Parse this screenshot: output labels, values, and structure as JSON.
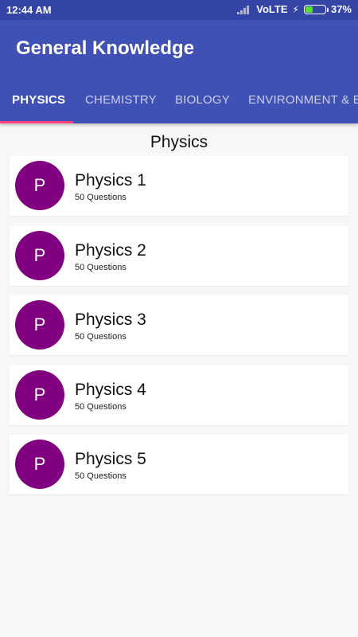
{
  "status_bar": {
    "time": "12:44 AM",
    "network": "VoLTE",
    "battery_percent": "37%",
    "battery_level": 0.37,
    "battery_color": "#5ddc3e"
  },
  "app": {
    "title": "General Knowledge",
    "primary_color": "#3f51b5",
    "accent_color": "#ff4081"
  },
  "tabs": [
    {
      "label": "PHYSICS",
      "active": true
    },
    {
      "label": "CHEMISTRY",
      "active": false
    },
    {
      "label": "BIOLOGY",
      "active": false
    },
    {
      "label": "ENVIRONMENT & EC",
      "active": false
    }
  ],
  "section": {
    "title": "Physics"
  },
  "items": [
    {
      "avatar_letter": "P",
      "title": "Physics 1",
      "subtitle": "50 Questions"
    },
    {
      "avatar_letter": "P",
      "title": "Physics 2",
      "subtitle": "50 Questions"
    },
    {
      "avatar_letter": "P",
      "title": "Physics 3",
      "subtitle": "50 Questions"
    },
    {
      "avatar_letter": "P",
      "title": "Physics 4",
      "subtitle": "50 Questions"
    },
    {
      "avatar_letter": "P",
      "title": "Physics 5",
      "subtitle": "50 Questions"
    }
  ],
  "avatar_color": "#800080"
}
